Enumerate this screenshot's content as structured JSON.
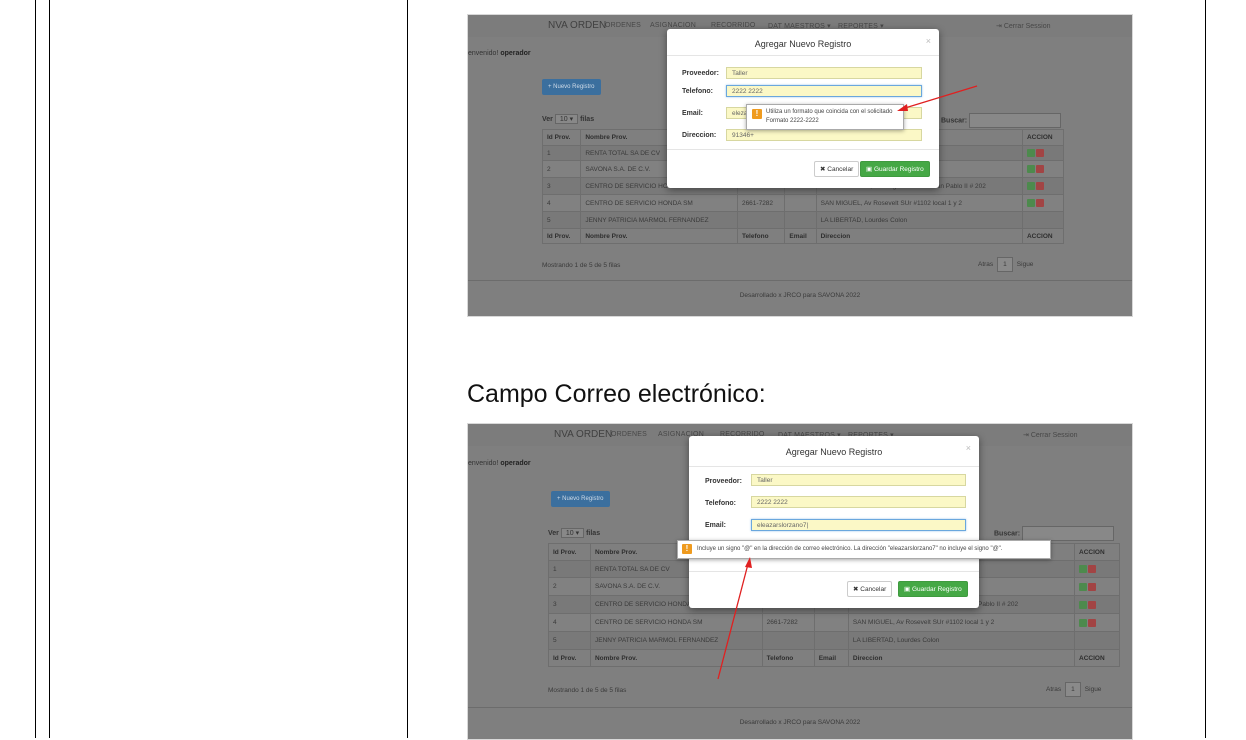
{
  "caption": "Campo Correo electrónico:",
  "app": {
    "brand": "NVA ORDEN",
    "nav": [
      "ORDENES",
      "ASIGNACION",
      "RECORRIDO",
      "DAT MAESTROS ▾",
      "REPORTES ▾"
    ],
    "logout": "Cerrar Session",
    "welcome_prefix": "envenido!",
    "welcome_user": "operador",
    "new_button": "+ Nuevo Registro",
    "entries_prefix": "Ver",
    "entries_value": "10",
    "entries_suffix": "filas",
    "search_label": "Buscar:",
    "columns": [
      "Id Prov.",
      "Nombre Prov.",
      "Telefono",
      "Email",
      "Direccion",
      "ACCION"
    ],
    "rows": [
      [
        "1",
        "RENTA TOTAL SA DE CV",
        "",
        "",
        ""
      ],
      [
        "2",
        "SAVONA S.A. DE C.V.",
        "",
        "",
        "LA LIBERTAD"
      ],
      [
        "3",
        "CENTRO DE SERVICIO HONDA SS",
        "2250-5258",
        "",
        "SAN SALVADOR, Prolongacion Alam Juan Pablo II # 202"
      ],
      [
        "4",
        "CENTRO DE SERVICIO HONDA SM",
        "2661-7282",
        "",
        "SAN MIGUEL, Av Rosevelt SUr #1102 local 1 y 2"
      ],
      [
        "5",
        "JENNY PATRICIA MARMOL FERNANDEZ",
        "",
        "",
        "LA LIBERTAD, Lourdes Colon"
      ]
    ],
    "info": "Mostrando 1 de 5 de 5 filas",
    "pager": {
      "prev": "Atras",
      "page": "1",
      "next": "Sigue"
    },
    "footer": "Desarrollado x JRCO para SAVONA 2022"
  },
  "modal": {
    "title": "Agregar Nuevo Registro",
    "close": "×",
    "proveedor_label": "Proveedor:",
    "proveedor_value": "Taller",
    "telefono_label": "Telefono:",
    "email_label": "Email:",
    "direccion_label": "Direccion:",
    "cancel": "✖ Cancelar",
    "save": "▣ Guardar Registro"
  },
  "shot1": {
    "telefono_value": "2222 2222",
    "email_value": "elezar",
    "direccion_value": "91346+",
    "tooltip_line1": "Utiliza un formato que coincida con el solicitado",
    "tooltip_line2": "Formato 2222-2222"
  },
  "shot2": {
    "telefono_value": "2222 2222",
    "email_value": "eleazarslorzano7|",
    "tooltip": "Incluye un signo \"@\" en la dirección de correo electrónico. La dirección \"eleazarslorzano7\" no incluye el signo \"@\"."
  },
  "colors": {
    "accent": "#3b6f9e",
    "save": "#45a845",
    "warn": "#ef9b1f",
    "arrow": "#e02020"
  }
}
